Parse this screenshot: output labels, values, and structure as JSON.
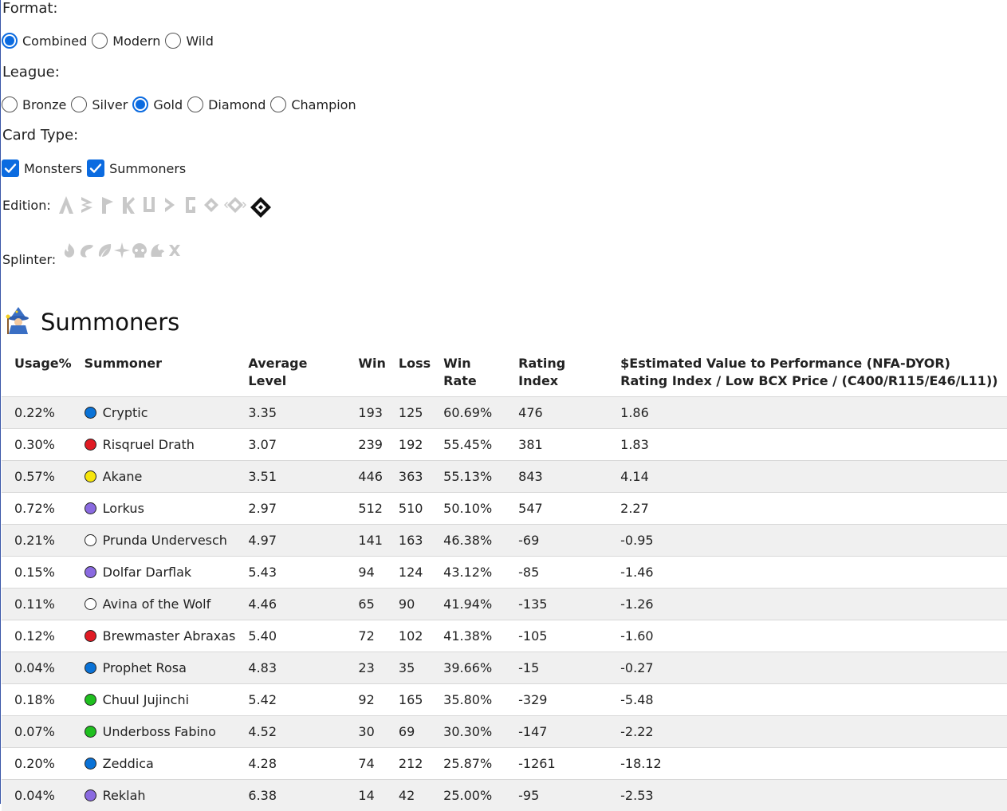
{
  "format": {
    "label": "Format:",
    "options": [
      "Combined",
      "Modern",
      "Wild"
    ],
    "selected": "Combined"
  },
  "league": {
    "label": "League:",
    "options": [
      "Bronze",
      "Silver",
      "Gold",
      "Diamond",
      "Champion"
    ],
    "selected": "Gold"
  },
  "card_type": {
    "label": "Card Type:",
    "options": [
      "Monsters",
      "Summoners"
    ],
    "checked": [
      "Monsters",
      "Summoners"
    ]
  },
  "edition": {
    "label": "Edition:",
    "icons": [
      "alpha-edition-icon",
      "beta-edition-icon",
      "promo-edition-icon",
      "reward-edition-icon",
      "untamed-edition-icon",
      "dice-edition-icon",
      "gladius-edition-icon",
      "chaos-legion-edition-icon",
      "riftwatchers-edition-icon",
      "soulbound-edition-icon"
    ],
    "active_index": 9
  },
  "splinter": {
    "label": "Splinter:",
    "icons": [
      "fire-splinter-icon",
      "water-splinter-icon",
      "earth-splinter-icon",
      "life-splinter-icon",
      "death-splinter-icon",
      "dragon-splinter-icon",
      "neutral-splinter-icon"
    ]
  },
  "section": {
    "title": "Summoners",
    "icon": "wizard-icon"
  },
  "table": {
    "headers": [
      "Usage%",
      "Summoner",
      "Average Level",
      "Win",
      "Loss",
      "Win Rate",
      "Rating Index",
      "$Estimated Value to Performance (NFA-DYOR) Rating Index / Low BCX Price / (C400/R115/E46/L11))"
    ],
    "rows": [
      {
        "usage": "0.22%",
        "name": "Cryptic",
        "color": "#0a72d6",
        "level": "3.35",
        "win": "193",
        "loss": "125",
        "win_rate": "60.69%",
        "rating": "476",
        "value": "1.86"
      },
      {
        "usage": "0.30%",
        "name": "Risqruel Drath",
        "color": "#e01b24",
        "level": "3.07",
        "win": "239",
        "loss": "192",
        "win_rate": "55.45%",
        "rating": "381",
        "value": "1.83"
      },
      {
        "usage": "0.57%",
        "name": "Akane",
        "color": "#f6e50c",
        "level": "3.51",
        "win": "446",
        "loss": "363",
        "win_rate": "55.13%",
        "rating": "843",
        "value": "4.14"
      },
      {
        "usage": "0.72%",
        "name": "Lorkus",
        "color": "#8a6ae0",
        "level": "2.97",
        "win": "512",
        "loss": "510",
        "win_rate": "50.10%",
        "rating": "547",
        "value": "2.27"
      },
      {
        "usage": "0.21%",
        "name": "Prunda Undervesch",
        "color": "#ffffff",
        "level": "4.97",
        "win": "141",
        "loss": "163",
        "win_rate": "46.38%",
        "rating": "-69",
        "value": "-0.95"
      },
      {
        "usage": "0.15%",
        "name": "Dolfar Darflak",
        "color": "#8a6ae0",
        "level": "5.43",
        "win": "94",
        "loss": "124",
        "win_rate": "43.12%",
        "rating": "-85",
        "value": "-1.46"
      },
      {
        "usage": "0.11%",
        "name": "Avina of the Wolf",
        "color": "#ffffff",
        "level": "4.46",
        "win": "65",
        "loss": "90",
        "win_rate": "41.94%",
        "rating": "-135",
        "value": "-1.26"
      },
      {
        "usage": "0.12%",
        "name": "Brewmaster Abraxas",
        "color": "#e01b24",
        "level": "5.40",
        "win": "72",
        "loss": "102",
        "win_rate": "41.38%",
        "rating": "-105",
        "value": "-1.60"
      },
      {
        "usage": "0.04%",
        "name": "Prophet Rosa",
        "color": "#0a72d6",
        "level": "4.83",
        "win": "23",
        "loss": "35",
        "win_rate": "39.66%",
        "rating": "-15",
        "value": "-0.27"
      },
      {
        "usage": "0.18%",
        "name": "Chuul Jujinchi",
        "color": "#1fbf1f",
        "level": "5.42",
        "win": "92",
        "loss": "165",
        "win_rate": "35.80%",
        "rating": "-329",
        "value": "-5.48"
      },
      {
        "usage": "0.07%",
        "name": "Underboss Fabino",
        "color": "#1fbf1f",
        "level": "4.52",
        "win": "30",
        "loss": "69",
        "win_rate": "30.30%",
        "rating": "-147",
        "value": "-2.22"
      },
      {
        "usage": "0.20%",
        "name": "Zeddica",
        "color": "#0a72d6",
        "level": "4.28",
        "win": "74",
        "loss": "212",
        "win_rate": "25.87%",
        "rating": "-1261",
        "value": "-18.12"
      },
      {
        "usage": "0.04%",
        "name": "Reklah",
        "color": "#8a6ae0",
        "level": "6.38",
        "win": "14",
        "loss": "42",
        "win_rate": "25.00%",
        "rating": "-95",
        "value": "-2.53"
      }
    ]
  },
  "colors": {
    "accent": "#0b6be0",
    "row_stripe": "#f0f0f0",
    "icon_inactive": "#c8c8c8"
  }
}
